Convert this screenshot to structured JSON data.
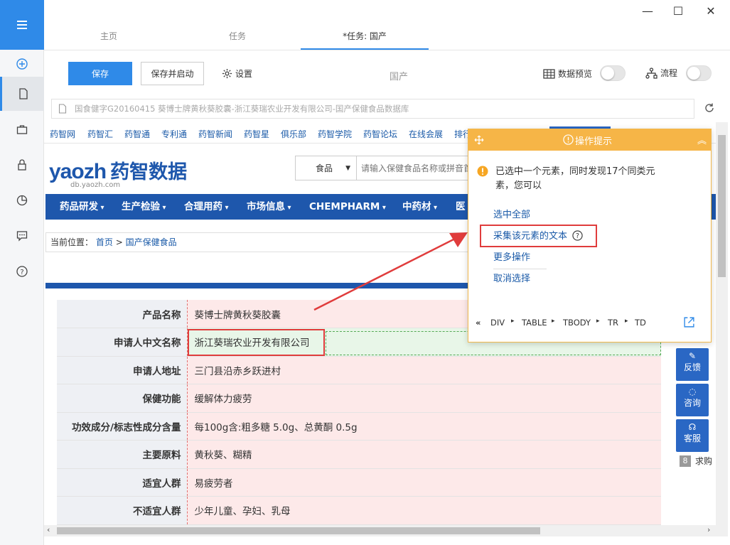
{
  "window": {
    "tabs": [
      {
        "label": "主页"
      },
      {
        "label": "任务"
      },
      {
        "label": "*任务: 国产"
      }
    ],
    "controls": {
      "minimize": "—",
      "maximize": "☐",
      "close": "✕"
    }
  },
  "sidebar": {
    "icons": [
      "menu-icon",
      "add-icon",
      "document-icon",
      "briefcase-icon",
      "lock-icon",
      "chart-icon",
      "message-icon",
      "help-icon"
    ]
  },
  "toolbar": {
    "save_label": "保存",
    "save_start_label": "保存并启动",
    "settings_label": "设置",
    "task_name": "国产",
    "data_preview_label": "数据预览",
    "flow_label": "流程"
  },
  "urlbar": {
    "value": "国食健字G20160415 葵博士牌黄秋葵胶囊-浙江葵瑞农业开发有限公司-国产保健食品数据库"
  },
  "site": {
    "top_links": [
      "药智网",
      "药智汇",
      "药智通",
      "专利通",
      "药智新闻",
      "药智星",
      "俱乐部",
      "药智学院",
      "药智论坛",
      "在线会展",
      "排行"
    ],
    "logo_text": "yaozh",
    "logo_cn": "药智数据",
    "logo_sub": "db.yaozh.com",
    "search_category": "食品",
    "search_placeholder": "请输入保健食品名称或拼音首",
    "main_nav": [
      "药品研发",
      "生产检验",
      "合理用药",
      "市场信息",
      "CHEMPHARM",
      "中药材",
      "医"
    ],
    "breadcrumb": {
      "prefix": "当前位置：",
      "home": "首页",
      "sep": ">",
      "current": "国产保健食品"
    },
    "detail_rows": [
      {
        "key": "产品名称",
        "value": "葵博士牌黄秋葵胶囊"
      },
      {
        "key": "申请人中文名称",
        "value": "浙江葵瑞农业开发有限公司"
      },
      {
        "key": "申请人地址",
        "value": "三门县沿赤乡跃进村"
      },
      {
        "key": "保健功能",
        "value": "缓解体力疲劳"
      },
      {
        "key": "功效成分/标志性成分含量",
        "value": "每100g含:粗多糖 5.0g、总黄酮 0.5g"
      },
      {
        "key": "主要原料",
        "value": "黄秋葵、糊精"
      },
      {
        "key": "适宜人群",
        "value": "易疲劳者"
      },
      {
        "key": "不适宜人群",
        "value": "少年儿童、孕妇、乳母"
      }
    ],
    "side_buttons": [
      {
        "label": "反馈"
      },
      {
        "label": "咨询"
      },
      {
        "label": "客服"
      }
    ],
    "side_list": [
      {
        "rank": "8",
        "text": "求购"
      }
    ]
  },
  "popup": {
    "title": "操作提示",
    "message": "已选中一个元素，同时发现17个同类元素，您可以",
    "actions": [
      "选中全部",
      "采集该元素的文本",
      "更多操作",
      "取消选择"
    ],
    "path": [
      "DIV",
      "TABLE",
      "TBODY",
      "TR",
      "TD"
    ]
  },
  "colors": {
    "accent": "#2f8ae8",
    "popup_header": "#f6b547",
    "nav_blue": "#1e57ac",
    "highlight_red": "#e03c3c"
  }
}
